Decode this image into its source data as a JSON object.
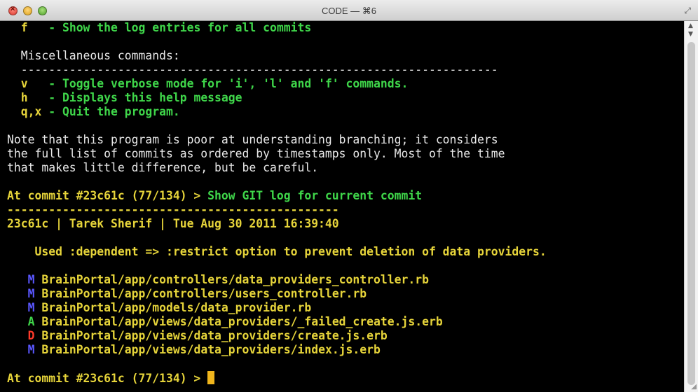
{
  "window": {
    "title": "CODE — ⌘6",
    "fullscreen_glyph": "⤢",
    "resize_glyph": "◢"
  },
  "terminal": {
    "lines": [
      {
        "key": "  f   ",
        "desc": "- Show the log entries for all commits"
      },
      {
        "text": "  Miscellaneous commands:"
      },
      {
        "text": "  ---------------------------------------------------------------------"
      },
      {
        "key": "  v   ",
        "desc": "- Toggle verbose mode for 'i', 'l' and 'f' commands."
      },
      {
        "key": "  h   ",
        "desc": "- Displays this help message"
      },
      {
        "key": "  q,x ",
        "desc": "- Quit the program."
      },
      {
        "text": "Note that this program is poor at understanding branching; it considers"
      },
      {
        "text": "the full list of commits as ordered by timestamps only. Most of the time"
      },
      {
        "text": "that makes little difference, but be careful."
      }
    ],
    "prompt1": {
      "prompt": "At commit #23c61c (77/134) > ",
      "command": "Show GIT log for current commit"
    },
    "separator": "------------------------------------------------",
    "commit_header": "23c61c | Tarek Sherif | Tue Aug 30 2011 16:39:40",
    "commit_message": "    Used :dependent => :restrict option to prevent deletion of data providers.",
    "files": [
      {
        "status": "M",
        "path": "BrainPortal/app/controllers/data_providers_controller.rb"
      },
      {
        "status": "M",
        "path": "BrainPortal/app/controllers/users_controller.rb"
      },
      {
        "status": "M",
        "path": "BrainPortal/app/models/data_provider.rb"
      },
      {
        "status": "A",
        "path": "BrainPortal/app/views/data_providers/_failed_create.js.erb"
      },
      {
        "status": "D",
        "path": "BrainPortal/app/views/data_providers/create.js.erb"
      },
      {
        "status": "M",
        "path": "BrainPortal/app/views/data_providers/index.js.erb"
      }
    ],
    "prompt2": "At commit #23c61c (77/134) > "
  },
  "colors": {
    "prompt": "#e6d43a",
    "command": "#3fd64a",
    "modified": "#5a57ff",
    "added": "#3fd64a",
    "deleted": "#ff3a2a",
    "cursor": "#f0b51c"
  }
}
